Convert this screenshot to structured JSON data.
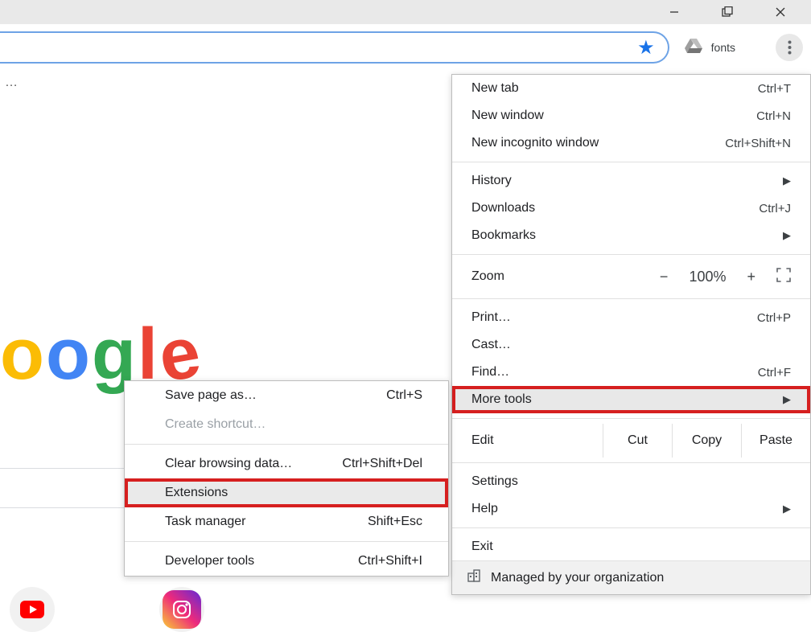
{
  "colors": {
    "star": "#1a73e8",
    "highlight": "#d61f1f"
  },
  "ext_label": "fonts",
  "logo_chars": [
    "o",
    "o",
    "g",
    "l",
    "e"
  ],
  "zoom_level": "100%",
  "main_menu": {
    "new_tab": {
      "label": "New tab",
      "short": "Ctrl+T"
    },
    "new_window": {
      "label": "New window",
      "short": "Ctrl+N"
    },
    "new_incognito": {
      "label": "New incognito window",
      "short": "Ctrl+Shift+N"
    },
    "history": {
      "label": "History"
    },
    "downloads": {
      "label": "Downloads",
      "short": "Ctrl+J"
    },
    "bookmarks": {
      "label": "Bookmarks"
    },
    "zoom": {
      "label": "Zoom"
    },
    "print": {
      "label": "Print…",
      "short": "Ctrl+P"
    },
    "cast": {
      "label": "Cast…"
    },
    "find": {
      "label": "Find…",
      "short": "Ctrl+F"
    },
    "more_tools": {
      "label": "More tools"
    },
    "edit": {
      "label": "Edit",
      "cut": "Cut",
      "copy": "Copy",
      "paste": "Paste"
    },
    "settings": {
      "label": "Settings"
    },
    "help": {
      "label": "Help"
    },
    "exit": {
      "label": "Exit"
    },
    "managed": {
      "label": "Managed by your organization"
    }
  },
  "sub_menu": {
    "save_page": {
      "label": "Save page as…",
      "short": "Ctrl+S"
    },
    "create_shortcut": {
      "label": "Create shortcut…"
    },
    "clear_data": {
      "label": "Clear browsing data…",
      "short": "Ctrl+Shift+Del"
    },
    "extensions": {
      "label": "Extensions"
    },
    "task_manager": {
      "label": "Task manager",
      "short": "Shift+Esc"
    },
    "dev_tools": {
      "label": "Developer tools",
      "short": "Ctrl+Shift+I"
    }
  }
}
